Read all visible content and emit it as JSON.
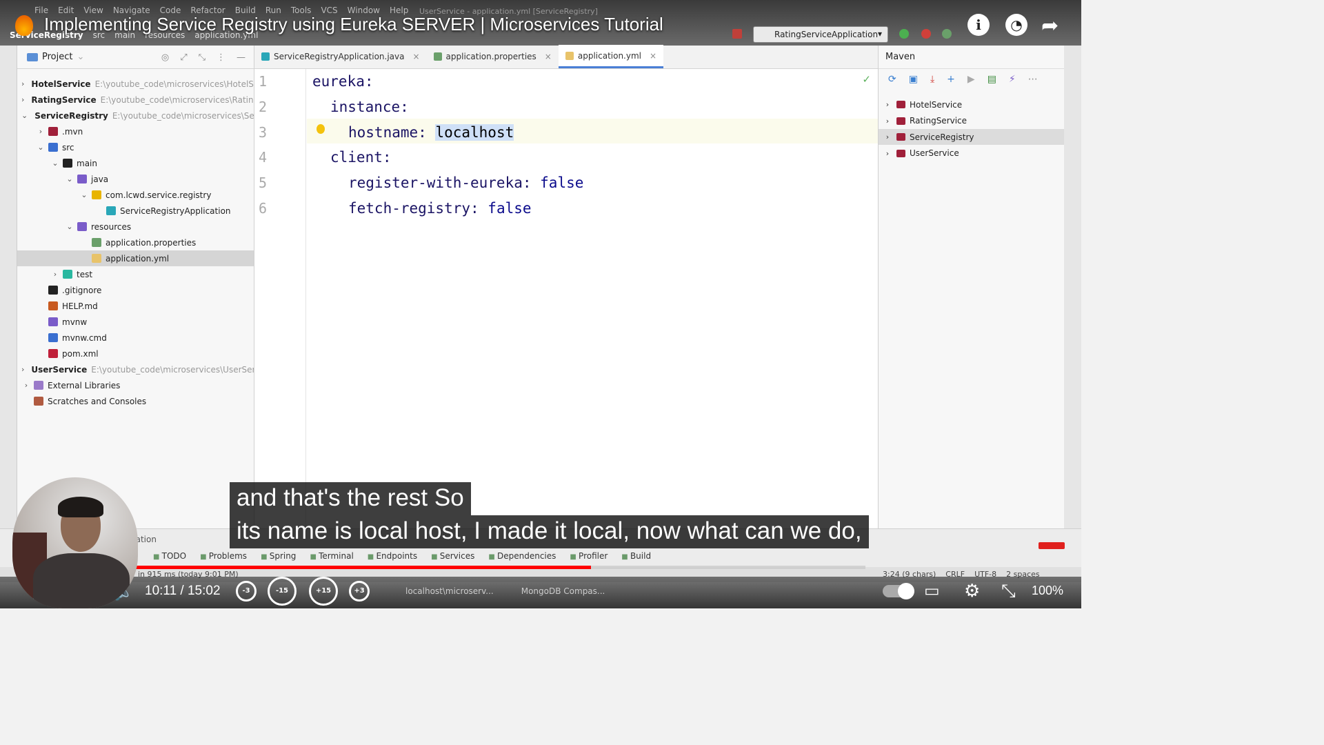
{
  "ide": {
    "menus": [
      "File",
      "Edit",
      "View",
      "Navigate",
      "Code",
      "Refactor",
      "Build",
      "Run",
      "Tools",
      "VCS",
      "Window",
      "Help"
    ],
    "window_title": "UserService - application.yml [ServiceRegistry]",
    "breadcrumb": [
      "ServiceRegistry",
      "src",
      "main",
      "resources",
      "application.yml"
    ],
    "run_config": "RatingServiceApplication"
  },
  "video": {
    "title": "Implementing Service Registry using Eureka SERVER | Microservices Tutorial",
    "current_time": "10:11",
    "duration": "15:02",
    "time_display": "10:11 / 15:02",
    "progress": 0.678,
    "zoom": "100%",
    "seek_back_3": "-3",
    "seek_back_15": "-15",
    "seek_fwd_15": "+15",
    "seek_fwd_3": "+3",
    "subtitles": [
      "and that's the rest  So",
      "its name is local host, I made it local, now what can we do,"
    ]
  },
  "project": {
    "header": "Project",
    "tree": [
      {
        "name": "HotelService",
        "path": "E:\\youtube_code\\microservices\\HotelSe",
        "bold": true,
        "chev": "›",
        "indent": 0,
        "color": "#7a5cc9"
      },
      {
        "name": "RatingService",
        "path": "E:\\youtube_code\\microservices\\Rating",
        "bold": true,
        "chev": "›",
        "indent": 0,
        "color": "#7a5cc9"
      },
      {
        "name": "ServiceRegistry",
        "path": "E:\\youtube_code\\microservices\\Serv",
        "bold": true,
        "chev": "⌄",
        "indent": 0,
        "color": "#7a5cc9"
      },
      {
        "name": ".mvn",
        "path": "",
        "bold": false,
        "chev": "›",
        "indent": 1,
        "color": "#a0203a"
      },
      {
        "name": "src",
        "path": "",
        "bold": false,
        "chev": "⌄",
        "indent": 1,
        "color": "#3a6fd0"
      },
      {
        "name": "main",
        "path": "",
        "bold": false,
        "chev": "⌄",
        "indent": 2,
        "color": "#222222"
      },
      {
        "name": "java",
        "path": "",
        "bold": false,
        "chev": "⌄",
        "indent": 3,
        "color": "#7a5cc9"
      },
      {
        "name": "com.lcwd.service.registry",
        "path": "",
        "bold": false,
        "chev": "⌄",
        "indent": 4,
        "color": "#e8b400"
      },
      {
        "name": "ServiceRegistryApplication",
        "path": "",
        "bold": false,
        "chev": "",
        "indent": 5,
        "color": "#2aa7b8"
      },
      {
        "name": "resources",
        "path": "",
        "bold": false,
        "chev": "⌄",
        "indent": 3,
        "color": "#7a5cc9"
      },
      {
        "name": "application.properties",
        "path": "",
        "bold": false,
        "chev": "",
        "indent": 4,
        "color": "#6ba06b"
      },
      {
        "name": "application.yml",
        "path": "",
        "bold": false,
        "chev": "",
        "indent": 4,
        "color": "#e8c36a",
        "selected": true
      },
      {
        "name": "test",
        "path": "",
        "bold": false,
        "chev": "›",
        "indent": 2,
        "color": "#2ab8a0"
      },
      {
        "name": ".gitignore",
        "path": "",
        "bold": false,
        "chev": "",
        "indent": 1,
        "color": "#222222"
      },
      {
        "name": "HELP.md",
        "path": "",
        "bold": false,
        "chev": "",
        "indent": 1,
        "color": "#c85a20"
      },
      {
        "name": "mvnw",
        "path": "",
        "bold": false,
        "chev": "",
        "indent": 1,
        "color": "#7a5cc9"
      },
      {
        "name": "mvnw.cmd",
        "path": "",
        "bold": false,
        "chev": "",
        "indent": 1,
        "color": "#3a6fd0"
      },
      {
        "name": "pom.xml",
        "path": "",
        "bold": false,
        "chev": "",
        "indent": 1,
        "color": "#c0203a"
      },
      {
        "name": "UserService",
        "path": "E:\\youtube_code\\microservices\\UserServ",
        "bold": true,
        "chev": "›",
        "indent": 0,
        "color": "#7a5cc9"
      },
      {
        "name": "External Libraries",
        "path": "",
        "bold": false,
        "chev": "›",
        "indent": 0,
        "color": "#9a7ac9"
      },
      {
        "name": "Scratches and Consoles",
        "path": "",
        "bold": false,
        "chev": "",
        "indent": 0,
        "color": "#b05a40"
      }
    ]
  },
  "editor": {
    "tabs": [
      {
        "label": "ServiceRegistryApplication.java",
        "active": false,
        "color": "#2aa7b8"
      },
      {
        "label": "application.properties",
        "active": false,
        "color": "#6ba06b"
      },
      {
        "label": "application.yml",
        "active": true,
        "color": "#e8c36a"
      }
    ],
    "lines": [
      {
        "num": "1",
        "indent": 0,
        "key": "eureka:",
        "value": ""
      },
      {
        "num": "2",
        "indent": 1,
        "key": "instance:",
        "value": ""
      },
      {
        "num": "3",
        "indent": 2,
        "key": "hostname: ",
        "value": "localhost",
        "selected": true
      },
      {
        "num": "4",
        "indent": 1,
        "key": "client:",
        "value": ""
      },
      {
        "num": "5",
        "indent": 2,
        "key": "register-with-eureka: ",
        "value": "false"
      },
      {
        "num": "6",
        "indent": 2,
        "key": "fetch-registry: ",
        "value": "false"
      }
    ]
  },
  "maven": {
    "header": "Maven",
    "items": [
      {
        "label": "HotelService",
        "selected": false
      },
      {
        "label": "RatingService",
        "selected": false
      },
      {
        "label": "ServiceRegistry",
        "selected": true
      },
      {
        "label": "UserService",
        "selected": false
      }
    ]
  },
  "bottom_tools": [
    "TODO",
    "Problems",
    "Spring",
    "Terminal",
    "Endpoints",
    "Services",
    "Dependencies",
    "Profiler",
    "Build"
  ],
  "bottom_location": "cation",
  "status": {
    "message": "in 915 ms (today 9:01 PM)",
    "caret": "3:24 (9 chars)",
    "line_sep": "CRLF",
    "encoding": "UTF-8",
    "indent": "2 spaces"
  },
  "taskbar": [
    "localhost\\microserv...",
    "MongoDB Compas..."
  ]
}
